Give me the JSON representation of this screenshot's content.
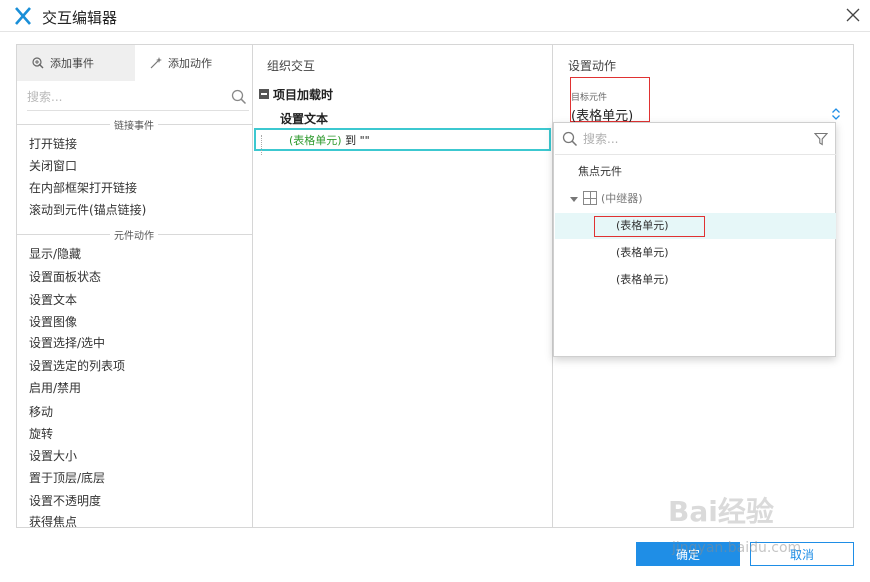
{
  "window": {
    "title": "交互编辑器"
  },
  "left_panel": {
    "tabs": [
      {
        "label": "添加事件",
        "active": true
      },
      {
        "label": "添加动作",
        "active": false
      }
    ],
    "search_placeholder": "搜索...",
    "sections": [
      {
        "title": "链接事件",
        "items": [
          "打开链接",
          "关闭窗口",
          "在内部框架打开链接",
          "滚动到元件(锚点链接)"
        ]
      },
      {
        "title": "元件动作",
        "items": [
          "显示/隐藏",
          "设置面板状态",
          "设置文本",
          "设置图像",
          "设置选择/选中",
          "设置选定的列表项",
          "启用/禁用",
          "移动",
          "旋转",
          "设置大小",
          "置于顶层/底层",
          "设置不透明度",
          "获得焦点"
        ]
      }
    ]
  },
  "middle_panel": {
    "heading": "组织交互",
    "event": "项目加载时",
    "action": "设置文本",
    "detail_target": "(表格单元)",
    "detail_rest": " 到 \"\""
  },
  "right_panel": {
    "heading": "设置动作",
    "target_label": "目标元件",
    "target_value": "(表格单元)"
  },
  "dropdown": {
    "search_placeholder": "搜索...",
    "items": {
      "focus": "焦点元件",
      "repeater": "(中继器)",
      "cell1": "(表格单元)",
      "cell2": "(表格单元)",
      "cell3": "(表格单元)"
    }
  },
  "buttons": {
    "ok": "确定",
    "cancel": "取消"
  },
  "watermark": {
    "logo_text": "Bai经验",
    "url": "jingyan.baidu.com"
  },
  "colors": {
    "accent": "#1f8ee6",
    "selection_border": "#3cc8d0",
    "highlight_row": "#e6f7f8",
    "annotation_red": "#e03232",
    "target_green": "#2e9a2e"
  }
}
